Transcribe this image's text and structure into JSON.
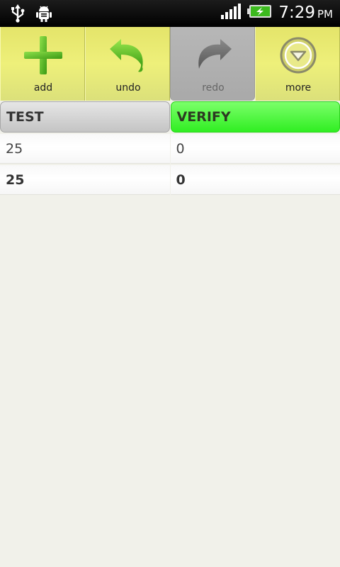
{
  "status_bar": {
    "time": "7:29",
    "ampm": "PM",
    "icons": [
      "usb-icon",
      "android-debug-icon",
      "signal-icon",
      "battery-charging-icon"
    ]
  },
  "toolbar": {
    "add_label": "add",
    "undo_label": "undo",
    "redo_label": "redo",
    "more_label": "more"
  },
  "table": {
    "headers": [
      "TEST",
      "VERIFY"
    ],
    "rows": [
      [
        "25",
        "0"
      ],
      [
        "25",
        "0"
      ]
    ]
  },
  "colors": {
    "toolbar_yellow": "#e9ec74",
    "header_green": "#4cf63a",
    "header_gray": "#d2d2d2"
  }
}
